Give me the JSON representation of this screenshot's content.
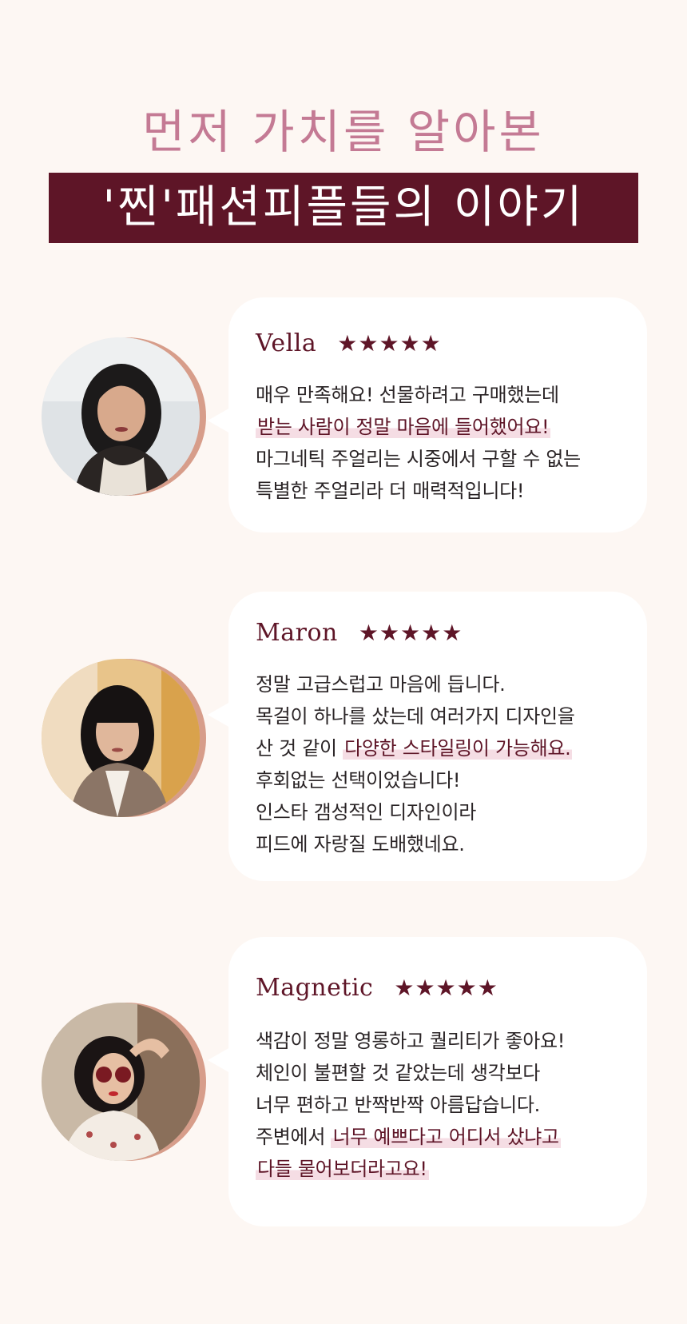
{
  "header": {
    "subtitle": "먼저 가치를 알아본",
    "title": "'찐'패션피플들의 이야기"
  },
  "colors": {
    "background": "#fdf7f3",
    "accent": "#5e1527",
    "subtitle": "#c47a94",
    "highlight": "#f5dde4",
    "ring": "#d79d8a"
  },
  "reviews": [
    {
      "name": "Vella",
      "rating": 5,
      "stars": "★★★★★",
      "lines": [
        {
          "pre": "매우 만족해요! 선물하려고 구매했는데",
          "hl": "",
          "post": ""
        },
        {
          "pre": "",
          "hl": "받는 사람이 정말 마음에 들어했어요!",
          "post": ""
        },
        {
          "pre": "마그네틱 주얼리는 시중에서 구할 수 없는",
          "hl": "",
          "post": ""
        },
        {
          "pre": "특별한 주얼리라 더 매력적입니다!",
          "hl": "",
          "post": ""
        }
      ]
    },
    {
      "name": "Maron",
      "rating": 5,
      "stars": "★★★★★",
      "lines": [
        {
          "pre": "정말 고급스럽고 마음에 듭니다.",
          "hl": "",
          "post": ""
        },
        {
          "pre": "목걸이 하나를 샀는데 여러가지 디자인을",
          "hl": "",
          "post": ""
        },
        {
          "pre": "산 것 같이 ",
          "hl": "다양한 스타일링이 가능해요.",
          "post": ""
        },
        {
          "pre": "후회없는 선택이었습니다!",
          "hl": "",
          "post": ""
        },
        {
          "pre": "인스타 갬성적인 디자인이라",
          "hl": "",
          "post": ""
        },
        {
          "pre": "피드에 자랑질 도배했네요.",
          "hl": "",
          "post": ""
        }
      ]
    },
    {
      "name": "Magnetic",
      "rating": 5,
      "stars": "★★★★★",
      "lines": [
        {
          "pre": "색감이 정말 영롱하고 퀄리티가 좋아요!",
          "hl": "",
          "post": ""
        },
        {
          "pre": "체인이 불편할 것 같았는데 생각보다",
          "hl": "",
          "post": ""
        },
        {
          "pre": "너무 편하고 반짝반짝 아름답습니다.",
          "hl": "",
          "post": ""
        },
        {
          "pre": "주변에서 ",
          "hl": "너무 예쁘다고 어디서 샀냐고",
          "post": ""
        },
        {
          "pre": "",
          "hl": "다들 물어보더라고요!",
          "post": ""
        }
      ]
    }
  ]
}
